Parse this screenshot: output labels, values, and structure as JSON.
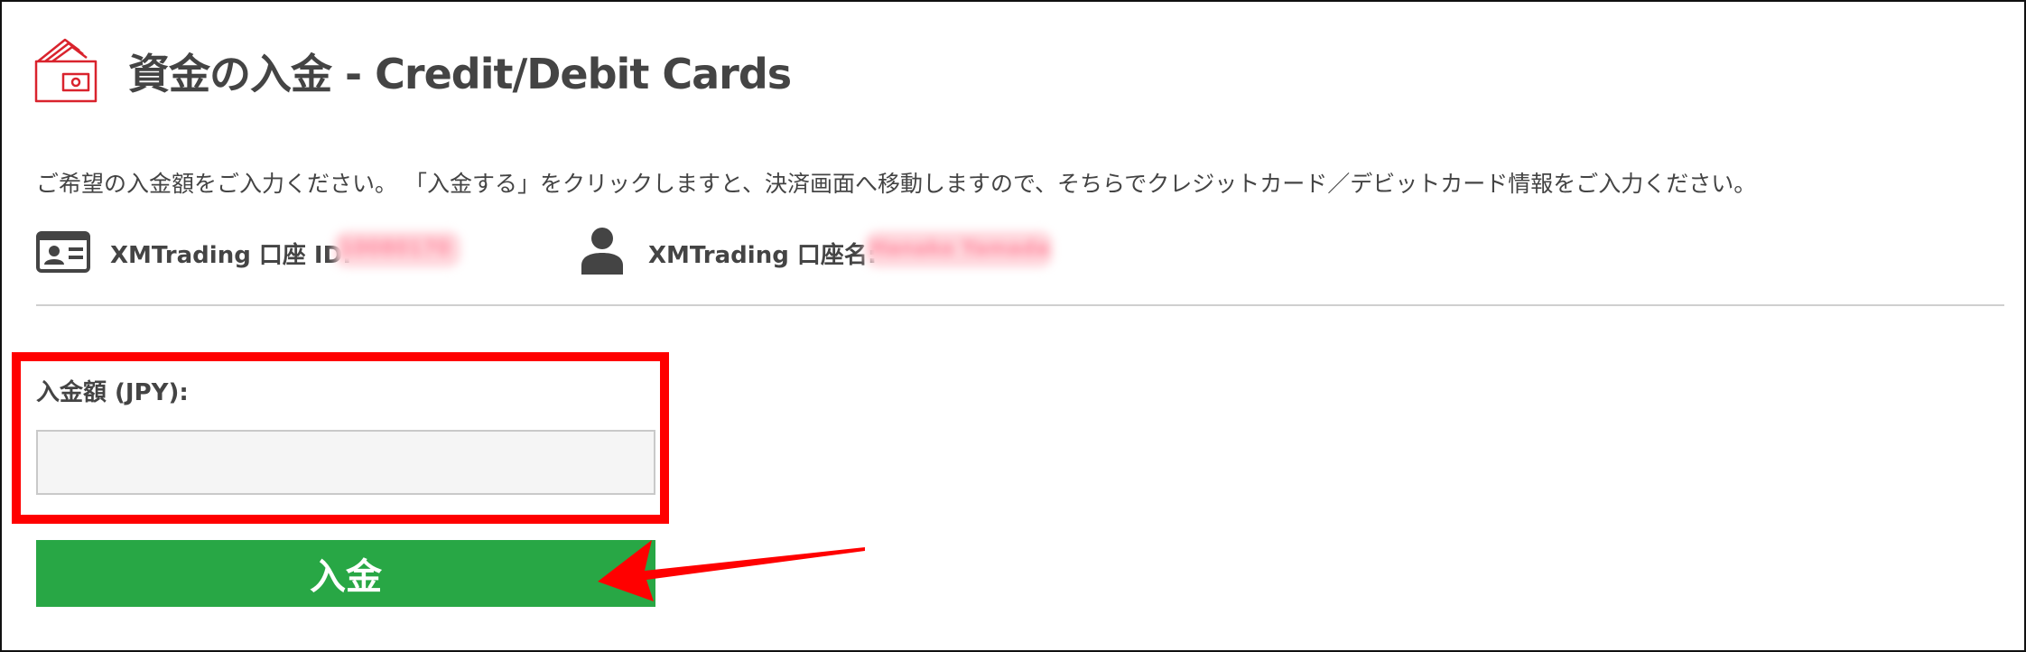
{
  "header": {
    "title": "資金の入金 - Credit/Debit Cards",
    "icon": "wallet-icon"
  },
  "instructions": "ご希望の入金額をご入力ください。 「入金する」をクリックしますと、決済画面へ移動しますので、そちらでクレジットカード／デビットカード情報をご入力ください。",
  "account": {
    "id_label": "XMTrading 口座 ID:",
    "id_value": "10080170",
    "id_icon": "id-card-icon",
    "name_label": "XMTrading 口座名:",
    "name_value": "Hanako Yamada",
    "name_icon": "user-icon"
  },
  "form": {
    "amount_label": "入金額 (JPY):",
    "amount_value": "",
    "amount_placeholder": "",
    "submit_label": "入金"
  },
  "colors": {
    "accent_red": "#ff0000",
    "icon_red": "#d9232d",
    "button_green": "#28a745",
    "text": "#444444"
  }
}
